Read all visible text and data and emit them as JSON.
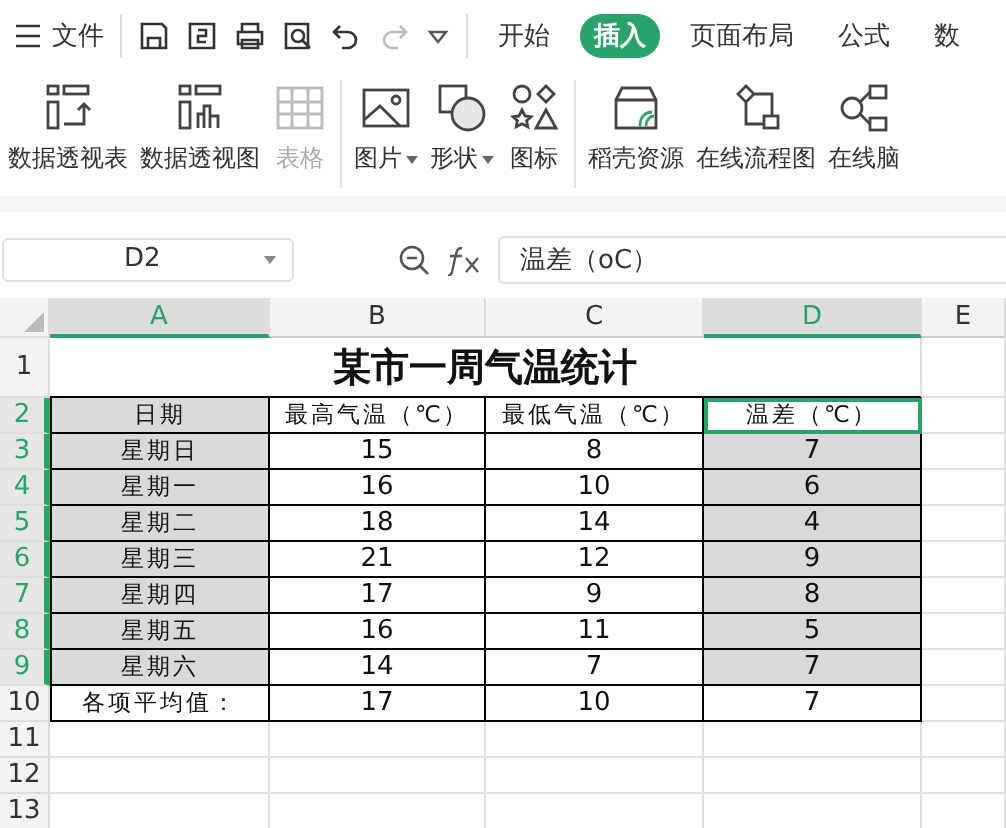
{
  "menu_bar": {
    "file_label": "文件",
    "tabs": [
      {
        "label": "开始",
        "selected": false
      },
      {
        "label": "插入",
        "selected": true
      },
      {
        "label": "页面布局",
        "selected": false
      },
      {
        "label": "公式",
        "selected": false
      },
      {
        "label": "数",
        "selected": false
      }
    ]
  },
  "ribbon": [
    {
      "kind": "pivot-table",
      "label": "数据透视表",
      "disabled": false,
      "dropdown": false
    },
    {
      "kind": "pivot-chart",
      "label": "数据透视图",
      "disabled": false,
      "dropdown": false
    },
    {
      "kind": "table",
      "label": "表格",
      "disabled": true,
      "dropdown": false
    },
    {
      "kind": "image",
      "label": "图片",
      "disabled": false,
      "dropdown": true
    },
    {
      "kind": "shape",
      "label": "形状",
      "disabled": false,
      "dropdown": true
    },
    {
      "kind": "icons",
      "label": "图标",
      "disabled": false,
      "dropdown": false
    },
    {
      "kind": "store",
      "label": "稻壳资源",
      "disabled": false,
      "dropdown": false
    },
    {
      "kind": "flowchart",
      "label": "在线流程图",
      "disabled": false,
      "dropdown": false
    },
    {
      "kind": "mindmap",
      "label": "在线脑",
      "disabled": false,
      "dropdown": false
    }
  ],
  "formula_bar": {
    "cell_ref": "D2",
    "formula": "温差（oC）"
  },
  "sheet": {
    "columns": [
      {
        "label": "A",
        "selected": true
      },
      {
        "label": "B",
        "selected": false
      },
      {
        "label": "C",
        "selected": false
      },
      {
        "label": "D",
        "selected": true
      },
      {
        "label": "E",
        "selected": false
      }
    ],
    "rows": [
      {
        "number": "1",
        "selected": false,
        "title": "某市一周气温统计"
      },
      {
        "number": "2",
        "selected": true,
        "cells": [
          {
            "text": "日期",
            "shaded": true,
            "active": false
          },
          {
            "text": "最高气温（℃）",
            "shaded": false,
            "active": false
          },
          {
            "text": "最低气温（℃）",
            "shaded": false,
            "active": false
          },
          {
            "text": "温差（℃）",
            "shaded": false,
            "active": true
          }
        ]
      },
      {
        "number": "3",
        "selected": true,
        "cells": [
          {
            "text": "星期日",
            "shaded": true,
            "active": false
          },
          {
            "text": "15",
            "shaded": false,
            "active": false
          },
          {
            "text": "8",
            "shaded": false,
            "active": false
          },
          {
            "text": "7",
            "shaded": true,
            "active": false
          }
        ]
      },
      {
        "number": "4",
        "selected": true,
        "cells": [
          {
            "text": "星期一",
            "shaded": true,
            "active": false
          },
          {
            "text": "16",
            "shaded": false,
            "active": false
          },
          {
            "text": "10",
            "shaded": false,
            "active": false
          },
          {
            "text": "6",
            "shaded": true,
            "active": false
          }
        ]
      },
      {
        "number": "5",
        "selected": true,
        "cells": [
          {
            "text": "星期二",
            "shaded": true,
            "active": false
          },
          {
            "text": "18",
            "shaded": false,
            "active": false
          },
          {
            "text": "14",
            "shaded": false,
            "active": false
          },
          {
            "text": "4",
            "shaded": true,
            "active": false
          }
        ]
      },
      {
        "number": "6",
        "selected": true,
        "cells": [
          {
            "text": "星期三",
            "shaded": true,
            "active": false
          },
          {
            "text": "21",
            "shaded": false,
            "active": false
          },
          {
            "text": "12",
            "shaded": false,
            "active": false
          },
          {
            "text": "9",
            "shaded": true,
            "active": false
          }
        ]
      },
      {
        "number": "7",
        "selected": true,
        "cells": [
          {
            "text": "星期四",
            "shaded": true,
            "active": false
          },
          {
            "text": "17",
            "shaded": false,
            "active": false
          },
          {
            "text": "9",
            "shaded": false,
            "active": false
          },
          {
            "text": "8",
            "shaded": true,
            "active": false
          }
        ]
      },
      {
        "number": "8",
        "selected": true,
        "cells": [
          {
            "text": "星期五",
            "shaded": true,
            "active": false
          },
          {
            "text": "16",
            "shaded": false,
            "active": false
          },
          {
            "text": "11",
            "shaded": false,
            "active": false
          },
          {
            "text": "5",
            "shaded": true,
            "active": false
          }
        ]
      },
      {
        "number": "9",
        "selected": true,
        "cells": [
          {
            "text": "星期六",
            "shaded": true,
            "active": false
          },
          {
            "text": "14",
            "shaded": false,
            "active": false
          },
          {
            "text": "7",
            "shaded": false,
            "active": false
          },
          {
            "text": "7",
            "shaded": true,
            "active": false
          }
        ]
      },
      {
        "number": "10",
        "selected": false,
        "cells": [
          {
            "text": "各项平均值：",
            "shaded": false,
            "active": false
          },
          {
            "text": "17",
            "shaded": false,
            "active": false
          },
          {
            "text": "10",
            "shaded": false,
            "active": false
          },
          {
            "text": "7",
            "shaded": false,
            "active": false
          }
        ]
      },
      {
        "number": "11",
        "selected": false
      },
      {
        "number": "12",
        "selected": false
      },
      {
        "number": "13",
        "selected": false
      }
    ]
  }
}
